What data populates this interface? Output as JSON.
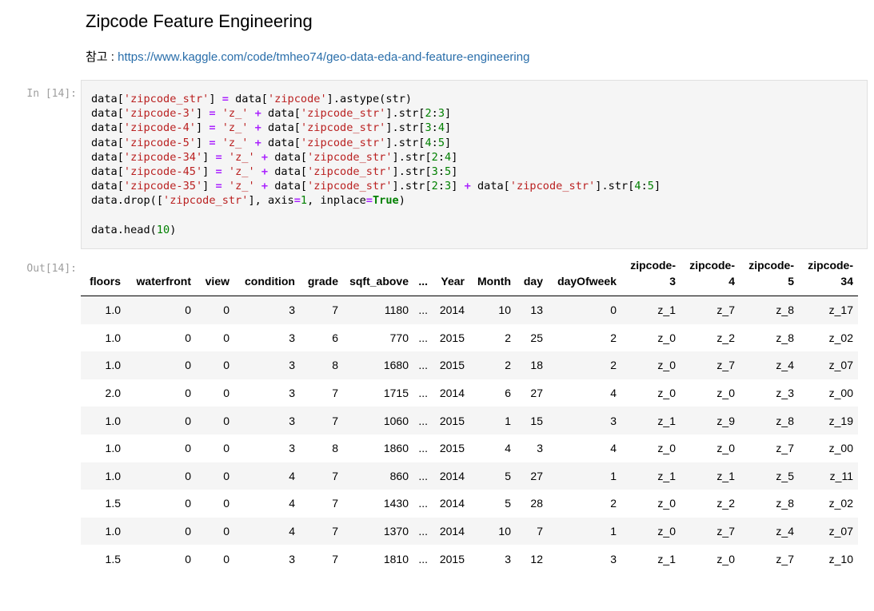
{
  "markdown": {
    "title": "Zipcode Feature Engineering",
    "ref_label": "참고 : ",
    "ref_link": "https://www.kaggle.com/code/tmheo74/geo-data-eda-and-feature-engineering"
  },
  "input_prompt": "In [14]:",
  "output_prompt": "Out[14]:",
  "table": {
    "columns": [
      "floors",
      "waterfront",
      "view",
      "condition",
      "grade",
      "sqft_above",
      "...",
      "Year",
      "Month",
      "day",
      "dayOfweek",
      "zipcode-3",
      "zipcode-4",
      "zipcode-5",
      "zipcode-34"
    ],
    "rows": [
      [
        "1.0",
        "0",
        "0",
        "3",
        "7",
        "1180",
        "...",
        "2014",
        "10",
        "13",
        "0",
        "z_1",
        "z_7",
        "z_8",
        "z_17"
      ],
      [
        "1.0",
        "0",
        "0",
        "3",
        "6",
        "770",
        "...",
        "2015",
        "2",
        "25",
        "2",
        "z_0",
        "z_2",
        "z_8",
        "z_02"
      ],
      [
        "1.0",
        "0",
        "0",
        "3",
        "8",
        "1680",
        "...",
        "2015",
        "2",
        "18",
        "2",
        "z_0",
        "z_7",
        "z_4",
        "z_07"
      ],
      [
        "2.0",
        "0",
        "0",
        "3",
        "7",
        "1715",
        "...",
        "2014",
        "6",
        "27",
        "4",
        "z_0",
        "z_0",
        "z_3",
        "z_00"
      ],
      [
        "1.0",
        "0",
        "0",
        "3",
        "7",
        "1060",
        "...",
        "2015",
        "1",
        "15",
        "3",
        "z_1",
        "z_9",
        "z_8",
        "z_19"
      ],
      [
        "1.0",
        "0",
        "0",
        "3",
        "8",
        "1860",
        "...",
        "2015",
        "4",
        "3",
        "4",
        "z_0",
        "z_0",
        "z_7",
        "z_00"
      ],
      [
        "1.0",
        "0",
        "0",
        "4",
        "7",
        "860",
        "...",
        "2014",
        "5",
        "27",
        "1",
        "z_1",
        "z_1",
        "z_5",
        "z_11"
      ],
      [
        "1.5",
        "0",
        "0",
        "4",
        "7",
        "1430",
        "...",
        "2014",
        "5",
        "28",
        "2",
        "z_0",
        "z_2",
        "z_8",
        "z_02"
      ],
      [
        "1.0",
        "0",
        "0",
        "4",
        "7",
        "1370",
        "...",
        "2014",
        "10",
        "7",
        "1",
        "z_0",
        "z_7",
        "z_4",
        "z_07"
      ],
      [
        "1.5",
        "0",
        "0",
        "3",
        "7",
        "1810",
        "...",
        "2015",
        "3",
        "12",
        "3",
        "z_1",
        "z_0",
        "z_7",
        "z_10"
      ]
    ]
  }
}
